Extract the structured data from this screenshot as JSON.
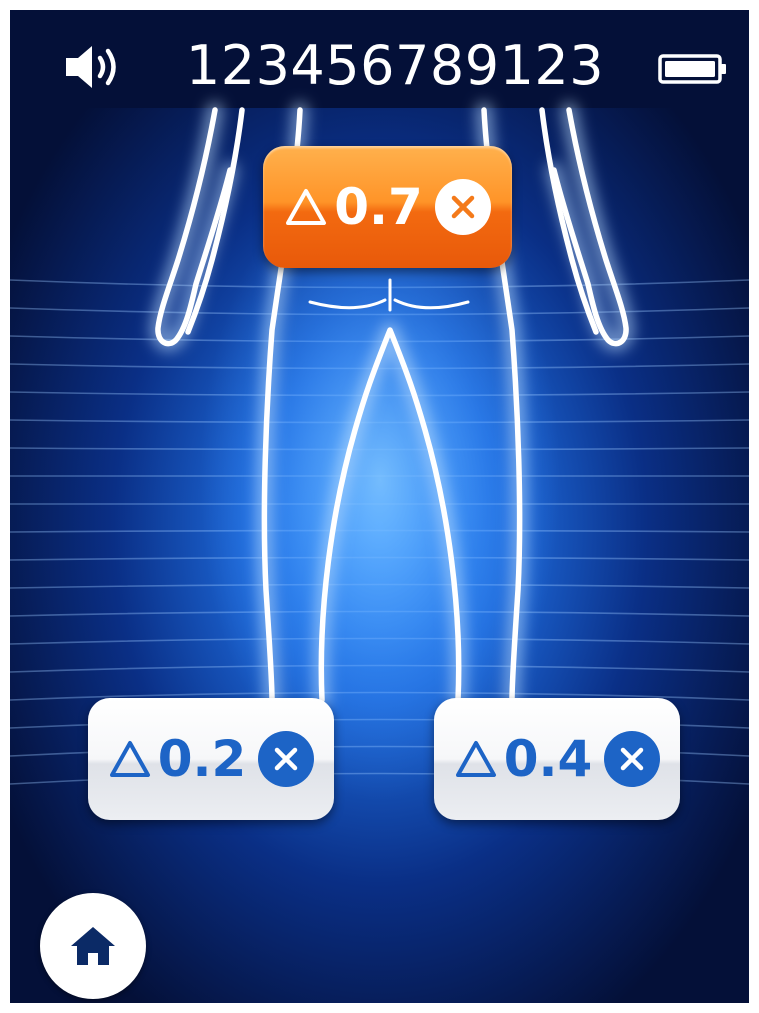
{
  "status_bar": {
    "device_id": "123456789123",
    "speaker_icon": "speaker-icon",
    "battery_icon": "battery-icon"
  },
  "body_map": {
    "figure": "human-lower-body-back-outline"
  },
  "measurements": [
    {
      "zone": "waist",
      "delta_symbol": "delta-icon",
      "value": "0.7",
      "clear_icon": "close-icon",
      "color": "#f47a1a"
    },
    {
      "zone": "left-leg",
      "delta_symbol": "delta-icon",
      "value": "0.2",
      "clear_icon": "close-icon",
      "color": "#1d64c6"
    },
    {
      "zone": "right-leg",
      "delta_symbol": "delta-icon",
      "value": "0.4",
      "clear_icon": "close-icon",
      "color": "#1d64c6"
    }
  ],
  "navigation": {
    "home_icon": "home-icon"
  },
  "colors": {
    "background": "#041038",
    "accent_blue": "#1d64c6",
    "accent_orange": "#f47a1a",
    "outline": "#ffffff"
  }
}
